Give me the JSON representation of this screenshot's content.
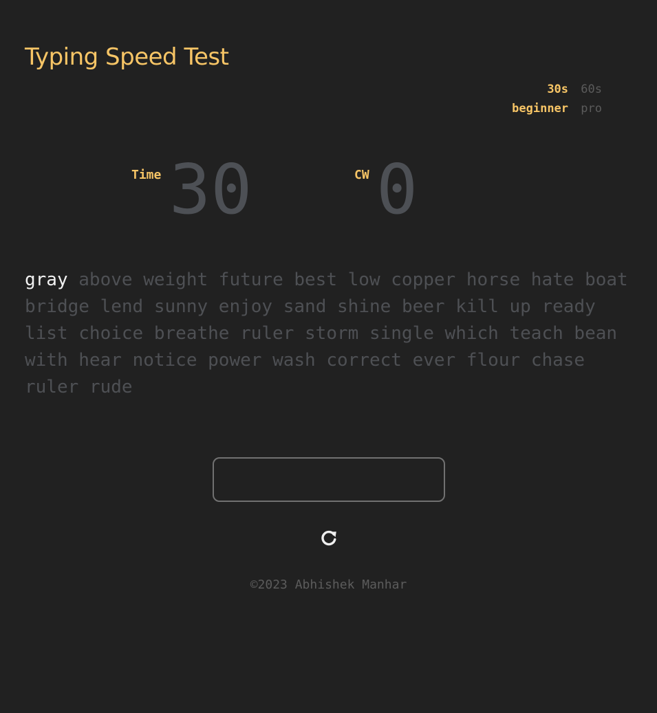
{
  "header": {
    "title": "Typing Speed Test"
  },
  "options": {
    "duration": {
      "selected": "30s",
      "other": "60s"
    },
    "difficulty": {
      "selected": "beginner",
      "other": "pro"
    }
  },
  "stats": {
    "time_label": "Time",
    "time_value": "30",
    "cw_label": "CW",
    "cw_value": "0"
  },
  "words": {
    "current": "gray",
    "upcoming": [
      "above",
      "weight",
      "future",
      "best",
      "low",
      "copper",
      "horse",
      "hate",
      "boat",
      "bridge",
      "lend",
      "sunny",
      "enjoy",
      "sand",
      "shine",
      "beer",
      "kill",
      "up",
      "ready",
      "list",
      "choice",
      "breathe",
      "ruler",
      "storm",
      "single",
      "which",
      "teach",
      "bean",
      "with",
      "hear",
      "notice",
      "power",
      "wash",
      "correct",
      "ever",
      "flour",
      "chase",
      "ruler",
      "rude"
    ]
  },
  "input": {
    "value": ""
  },
  "restart": {
    "icon": "restart-icon"
  },
  "footer": {
    "text": "©2023 Abhishek Manhar"
  },
  "colors": {
    "background": "#212121",
    "accent": "#f7c566",
    "muted_text": "#4e5054",
    "current_word": "#f2f2f2",
    "inactive_option": "#5b5b5b"
  }
}
